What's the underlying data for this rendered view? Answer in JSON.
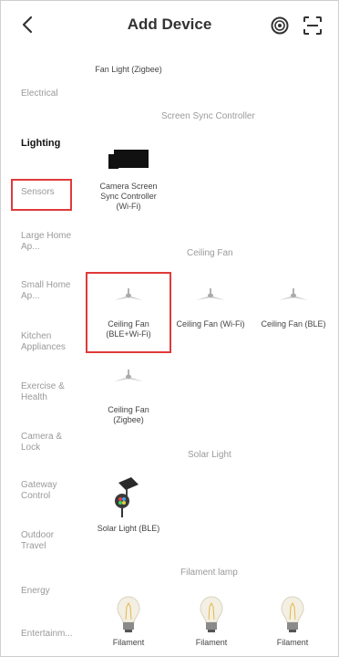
{
  "header": {
    "title": "Add Device",
    "back_icon": "chevron-left-icon",
    "right_icons": [
      "target-icon",
      "scan-icon"
    ]
  },
  "sidebar": {
    "items": [
      {
        "label": "Electrical",
        "active": false
      },
      {
        "label": "Lighting",
        "active": true
      },
      {
        "label": "Sensors",
        "active": false
      },
      {
        "label": "Large Home Ap...",
        "active": false
      },
      {
        "label": "Small Home Ap...",
        "active": false
      },
      {
        "label": "Kitchen Appliances",
        "active": false
      },
      {
        "label": "Exercise & Health",
        "active": false
      },
      {
        "label": "Camera & Lock",
        "active": false
      },
      {
        "label": "Gateway Control",
        "active": false
      },
      {
        "label": "Outdoor Travel",
        "active": false
      },
      {
        "label": "Energy",
        "active": false
      },
      {
        "label": "Entertainm...",
        "active": false
      }
    ]
  },
  "main": {
    "top_partial_item": "Fan Light (Zigbee)",
    "sections": [
      {
        "title": "Screen Sync Controller",
        "items": [
          "Camera Screen Sync Controller (Wi-Fi)"
        ]
      },
      {
        "title": "Ceiling Fan",
        "items": [
          "Ceiling Fan (BLE+Wi-Fi)",
          "Ceiling Fan (Wi-Fi)",
          "Ceiling Fan (BLE)",
          "Ceiling Fan (Zigbee)"
        ]
      },
      {
        "title": "Solar Light",
        "items": [
          "Solar Light (BLE)"
        ]
      },
      {
        "title": "Filament lamp",
        "items": [
          "Filament",
          "Filament",
          "Filament"
        ]
      }
    ]
  },
  "colors": {
    "highlight": "#e03a3a"
  }
}
